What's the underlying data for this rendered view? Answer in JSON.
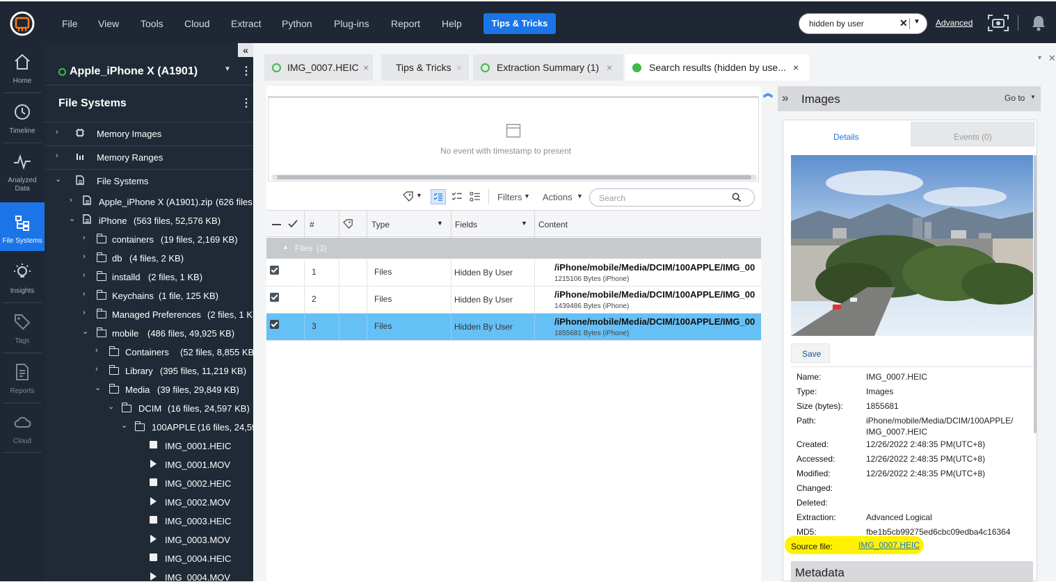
{
  "topbar": {
    "menu": [
      "File",
      "View",
      "Tools",
      "Cloud",
      "Extract",
      "Python",
      "Plug-ins",
      "Report",
      "Help"
    ],
    "tips_button": "Tips & Tricks",
    "search_value": "hidden by user",
    "advanced_link": "Advanced"
  },
  "rail": {
    "items": [
      {
        "label": "Home",
        "icon": "home-icon"
      },
      {
        "label": "Timeline",
        "icon": "clock-icon"
      },
      {
        "label": "Analyzed",
        "label2": "Data",
        "icon": "pulse-icon"
      },
      {
        "label": "File Systems",
        "icon": "file-systems-icon"
      },
      {
        "label": "Insights",
        "icon": "bulb-icon"
      },
      {
        "label": "Tags",
        "icon": "tag-icon"
      },
      {
        "label": "Reports",
        "icon": "report-icon"
      },
      {
        "label": "Cloud",
        "icon": "cloud-icon"
      }
    ]
  },
  "tree": {
    "device": "Apple_iPhone X (A1901)",
    "section_title": "File Systems",
    "nodes": [
      {
        "label": "Memory Images"
      },
      {
        "label": "Memory Ranges"
      },
      {
        "label": "File Systems"
      },
      {
        "label": "Apple_iPhone X (A1901).zip",
        "count": "(626 files"
      },
      {
        "label": "iPhone",
        "count": "(563 files, 52,576 KB)"
      },
      {
        "label": "containers",
        "count": "(19 files, 2,169 KB)"
      },
      {
        "label": "db",
        "count": "(4 files, 2 KB)"
      },
      {
        "label": "installd",
        "count": "(2 files, 1 KB)"
      },
      {
        "label": "Keychains",
        "count": "(1 file, 125 KB)"
      },
      {
        "label": "Managed Preferences",
        "count": "(2 files, 1 K"
      },
      {
        "label": "mobile",
        "count": "(486 files, 49,925 KB)"
      },
      {
        "label": "Containers",
        "count": "(52 files, 8,855 KB)"
      },
      {
        "label": "Library",
        "count": "(395 files, 11,219 KB)"
      },
      {
        "label": "Media",
        "count": "(39 files, 29,849 KB)"
      },
      {
        "label": "DCIM",
        "count": "(16 files, 24,597 KB)"
      },
      {
        "label": "100APPLE",
        "count": "(16 files, 24,59"
      },
      {
        "label": "IMG_0001.HEIC"
      },
      {
        "label": "IMG_0001.MOV"
      },
      {
        "label": "IMG_0002.HEIC"
      },
      {
        "label": "IMG_0002.MOV"
      },
      {
        "label": "IMG_0003.HEIC"
      },
      {
        "label": "IMG_0003.MOV"
      },
      {
        "label": "IMG_0004.HEIC"
      },
      {
        "label": "IMG_0004.MOV"
      }
    ]
  },
  "tabs": [
    {
      "label": "IMG_0007.HEIC"
    },
    {
      "label": "Tips & Tricks"
    },
    {
      "label": "Extraction Summary (1)"
    },
    {
      "label": "Search results (hidden by use..."
    }
  ],
  "timeline": {
    "empty_text": "No event with timestamp to present"
  },
  "toolbar": {
    "filters": "Filters",
    "actions": "Actions",
    "search_placeholder": "Search"
  },
  "grid": {
    "headers": {
      "num": "#",
      "type": "Type",
      "fields": "Fields",
      "content": "Content"
    },
    "group_label": "Files",
    "group_count": "(3)",
    "rows": [
      {
        "num": "1",
        "type": "Files",
        "fields": "Hidden By User",
        "path": "/iPhone/mobile/Media/DCIM/100APPLE/IMG_00",
        "size": "1215106 Bytes (iPhone)",
        "checked": true,
        "selected": false
      },
      {
        "num": "2",
        "type": "Files",
        "fields": "Hidden By User",
        "path": "/iPhone/mobile/Media/DCIM/100APPLE/IMG_00",
        "size": "1439486 Bytes (iPhone)",
        "checked": true,
        "selected": false
      },
      {
        "num": "3",
        "type": "Files",
        "fields": "Hidden By User",
        "path": "/iPhone/mobile/Media/DCIM/100APPLE/IMG_00",
        "size": "1855681 Bytes (iPhone)",
        "checked": true,
        "selected": true
      }
    ]
  },
  "details": {
    "title": "Images",
    "goto": "Go to",
    "tab_details": "Details",
    "tab_events": "Events (0)",
    "save": "Save",
    "fields": [
      {
        "k": "Name:",
        "v": "IMG_0007.HEIC"
      },
      {
        "k": "Type:",
        "v": "Images"
      },
      {
        "k": "Size (bytes):",
        "v": "1855681"
      },
      {
        "k": "Path:",
        "v": "iPhone/mobile/Media/DCIM/100APPLE/",
        "v2": "IMG_0007.HEIC"
      },
      {
        "k": "Created:",
        "v": "12/26/2022 2:48:35 PM(UTC+8)"
      },
      {
        "k": "Accessed:",
        "v": "12/26/2022 2:48:35 PM(UTC+8)"
      },
      {
        "k": "Modified:",
        "v": "12/26/2022 2:48:35 PM(UTC+8)"
      },
      {
        "k": "Changed:",
        "v": ""
      },
      {
        "k": "Deleted:",
        "v": ""
      },
      {
        "k": "Extraction:",
        "v": "Advanced Logical"
      },
      {
        "k": "MD5:",
        "v": "fbe1b5cb99275ed6cbc09edba4c16364"
      }
    ],
    "source_label": "Source file:",
    "source_link": "IMG_0007.HEIC",
    "metadata_title": "Metadata"
  },
  "colors": {
    "accent": "#1b74e8",
    "selected_row": "#65c0f5",
    "highlight": "#fff200",
    "status_green": "#3fb950"
  }
}
